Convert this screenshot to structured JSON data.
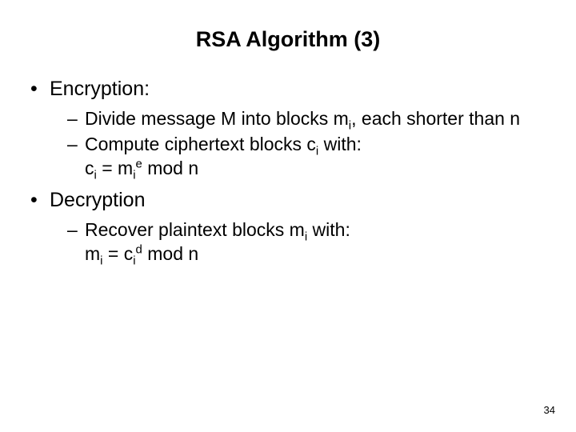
{
  "title": "RSA Algorithm (3)",
  "bullets": {
    "encryption": {
      "label": "Encryption:",
      "sub": {
        "divide_pre": "Divide message M into blocks m",
        "divide_post": ", each shorter than n",
        "compute_pre": "Compute ciphertext blocks c",
        "compute_post": " with:",
        "formula_c": "c",
        "formula_eq": " = m",
        "formula_mod": " mod n"
      }
    },
    "decryption": {
      "label": "Decryption",
      "sub": {
        "recover_pre": "Recover plaintext blocks m",
        "recover_post": " with:",
        "formula_m": "m",
        "formula_eq": " = c",
        "formula_mod": " mod n"
      }
    }
  },
  "subscripts": {
    "i": "i"
  },
  "superscripts": {
    "e": "e",
    "d": "d"
  },
  "page_number": "34"
}
